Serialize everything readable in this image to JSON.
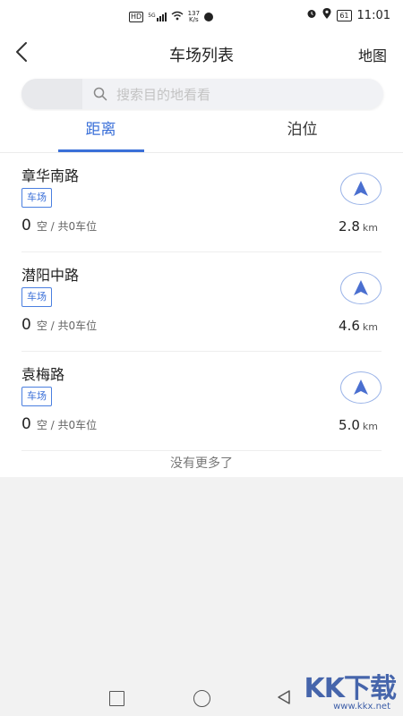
{
  "status_bar": {
    "hd": "HD",
    "signal_label": "5G",
    "net_speed": "137",
    "net_unit": "K/s",
    "battery": "61",
    "time": "11:01"
  },
  "header": {
    "title": "车场列表",
    "map_label": "地图"
  },
  "search": {
    "placeholder": "搜索目的地看看"
  },
  "tabs": [
    {
      "label": "距离",
      "active": true
    },
    {
      "label": "泊位",
      "active": false
    }
  ],
  "lots": [
    {
      "name": "章华南路",
      "tag": "车场",
      "free": "0",
      "free_label": "空 / 共0车位",
      "distance": "2.8",
      "unit": "km"
    },
    {
      "name": "潜阳中路",
      "tag": "车场",
      "free": "0",
      "free_label": "空 / 共0车位",
      "distance": "4.6",
      "unit": "km"
    },
    {
      "name": "袁梅路",
      "tag": "车场",
      "free": "0",
      "free_label": "空 / 共0车位",
      "distance": "5.0",
      "unit": "km"
    }
  ],
  "footer_text": "没有更多了",
  "watermark": {
    "text": "KK下载",
    "url": "www.kkx.net"
  },
  "colors": {
    "accent": "#3a6fd8",
    "nav_arrow": "#4a6fd0"
  }
}
